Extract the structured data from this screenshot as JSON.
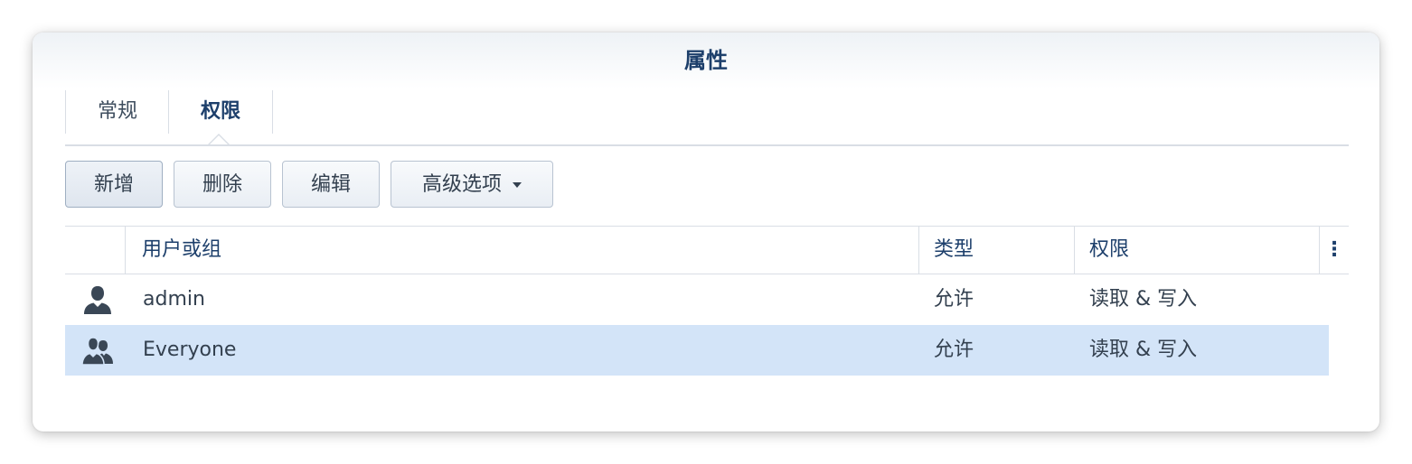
{
  "window": {
    "title": "属性"
  },
  "tabs": [
    {
      "label": "常规"
    },
    {
      "label": "权限"
    }
  ],
  "toolbar": {
    "add_label": "新增",
    "delete_label": "删除",
    "edit_label": "编辑",
    "advanced_label": "高级选项"
  },
  "table": {
    "columns": [
      "用户或组",
      "类型",
      "权限"
    ],
    "menu_glyph": "⋮",
    "rows": [
      {
        "icon": "user-icon",
        "name": "admin",
        "type": "允许",
        "permission": "读取 & 写入"
      },
      {
        "icon": "group-icon",
        "name": "Everyone",
        "type": "允许",
        "permission": "读取 & 写入"
      }
    ]
  },
  "colors": {
    "accent": "#1d3f6b",
    "selected_row": "#d3e4f8",
    "border": "#d9dee5"
  }
}
